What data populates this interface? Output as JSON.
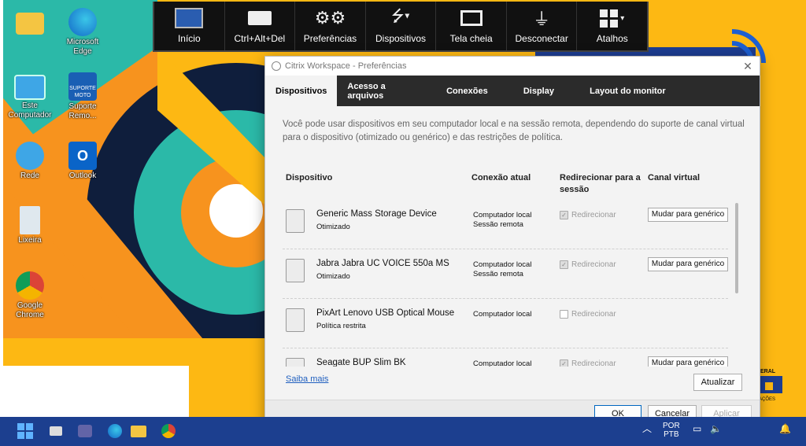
{
  "desktop": {
    "icons": [
      {
        "label": "Microsoft Edge"
      },
      {
        "label": "Este Computador"
      },
      {
        "label": "Suporte Remo..."
      },
      {
        "label": "Rede"
      },
      {
        "label": "Outlook"
      },
      {
        "label": "Lixeira"
      },
      {
        "label": "Google Chrome"
      }
    ],
    "support_tile_text": "SUPORTE MOTO"
  },
  "toolbar": {
    "items": [
      {
        "label": "Início",
        "icon": "monitor-icon"
      },
      {
        "label": "Ctrl+Alt+Del",
        "icon": "keyboard-icon"
      },
      {
        "label": "Preferências",
        "icon": "gears-icon"
      },
      {
        "label": "Dispositivos",
        "icon": "usb-icon"
      },
      {
        "label": "Tela cheia",
        "icon": "fullscreen-icon"
      },
      {
        "label": "Desconectar",
        "icon": "plug-icon"
      },
      {
        "label": "Atalhos",
        "icon": "grid-icon"
      }
    ]
  },
  "dialog": {
    "title": "Citrix Workspace - Preferências",
    "tabs": [
      "Dispositivos",
      "Acesso a arquivos",
      "Conexões",
      "Display",
      "Layout do monitor"
    ],
    "active_tab": "Dispositivos",
    "description": "Você pode usar dispositivos em seu computador local e na sessão remota, dependendo do suporte de canal virtual para o dispositivo (otimizado ou genérico) e das restrições de política.",
    "columns": {
      "device": "Dispositivo",
      "connection": "Conexão atual",
      "redirect": "Redirecionar para a sessão",
      "channel": "Canal virtual"
    },
    "devices": [
      {
        "name": "Generic Mass Storage Device",
        "sub": "Otimizado",
        "conn1": "Computador local",
        "conn2": "Sessão remota",
        "redirect": "Redirecionar",
        "checked": true,
        "action": "Mudar para genérico"
      },
      {
        "name": "Jabra Jabra UC VOICE 550a MS",
        "sub": "Otimizado",
        "conn1": "Computador local",
        "conn2": "Sessão remota",
        "redirect": "Redirecionar",
        "checked": true,
        "action": "Mudar para genérico"
      },
      {
        "name": "PixArt Lenovo USB Optical Mouse",
        "sub": "Política restrita",
        "conn1": "Computador local",
        "conn2": "",
        "redirect": "Redirecionar",
        "checked": false,
        "action": ""
      },
      {
        "name": "Seagate BUP Slim BK",
        "sub": "",
        "conn1": "Computador local",
        "conn2": "",
        "redirect": "Redirecionar",
        "checked": true,
        "action": "Mudar para genérico"
      }
    ],
    "learn_more": "Saiba mais",
    "refresh": "Atualizar",
    "ok": "OK",
    "cancel": "Cancelar",
    "apply": "Aplicar"
  },
  "taskbar": {
    "lang1": "POR",
    "lang2": "PTB"
  },
  "wallpaper_text": {
    "right_1": "ERAL",
    "right_2": "AÇÕES"
  },
  "colors": {
    "wallpaper_yellow": "#fdb813",
    "wallpaper_orange": "#f7931e",
    "wallpaper_teal": "#2bb9a8",
    "wallpaper_navy": "#0f1e3c",
    "taskbar": "#1c3f8f",
    "tab_bar": "#2b2b2b",
    "link": "#1f5fbf"
  }
}
